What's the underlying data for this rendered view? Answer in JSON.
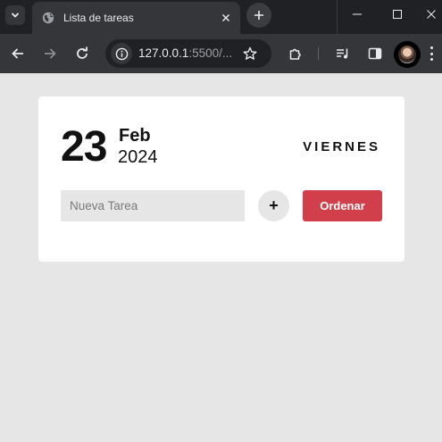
{
  "browser": {
    "tab_title": "Lista de tareas",
    "url_host": "127.0.0.1",
    "url_rest": ":5500/..."
  },
  "date": {
    "day": "23",
    "month": "Feb",
    "year": "2024",
    "weekday": "VIERNES"
  },
  "form": {
    "input_placeholder": "Nueva Tarea",
    "input_value": "",
    "add_label": "+",
    "sort_label": "Ordenar"
  },
  "colors": {
    "page_background": "#e6e6e6",
    "card_background": "#ffffff",
    "sort_button": "#d1404a",
    "browser_frame": "#202124",
    "browser_toolbar": "#35363a"
  },
  "icons": {
    "tab_search": "chevron-down-icon",
    "favicon": "globe-icon",
    "tab_close": "close-icon",
    "new_tab": "plus-icon",
    "back": "arrow-left-icon",
    "forward": "arrow-right-icon",
    "reload": "reload-icon",
    "site_info": "info-icon",
    "bookmark": "star-icon",
    "extensions": "puzzle-icon",
    "media": "media-queue-icon",
    "side_panel": "side-panel-icon",
    "menu": "kebab-menu-icon"
  }
}
